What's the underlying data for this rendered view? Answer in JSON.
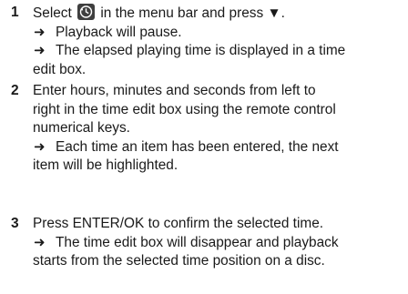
{
  "steps": [
    {
      "number": "1",
      "instruction_before": "Select ",
      "instruction_icon": "time-search-icon",
      "instruction_after": " in the menu bar and press ▼.",
      "results": [
        {
          "line1": "Playback will pause.",
          "line2": ""
        },
        {
          "line1": "The elapsed playing time is displayed in a time",
          "line2": "edit box."
        }
      ]
    },
    {
      "number": "2",
      "instruction_lines": [
        "Enter hours, minutes and seconds from left to",
        "right in the time edit box using the remote control",
        "numerical keys."
      ],
      "results": [
        {
          "line1": "Each time an item has been entered, the next",
          "line2": "item will be highlighted."
        }
      ]
    },
    {
      "number": "3",
      "instruction_lines": [
        "Press ENTER/OK to confirm the selected time."
      ],
      "results": [
        {
          "line1": "The time edit box will disappear and playback",
          "line2": "starts from the selected time position on a disc."
        }
      ]
    }
  ],
  "arrow_glyph": "➜"
}
